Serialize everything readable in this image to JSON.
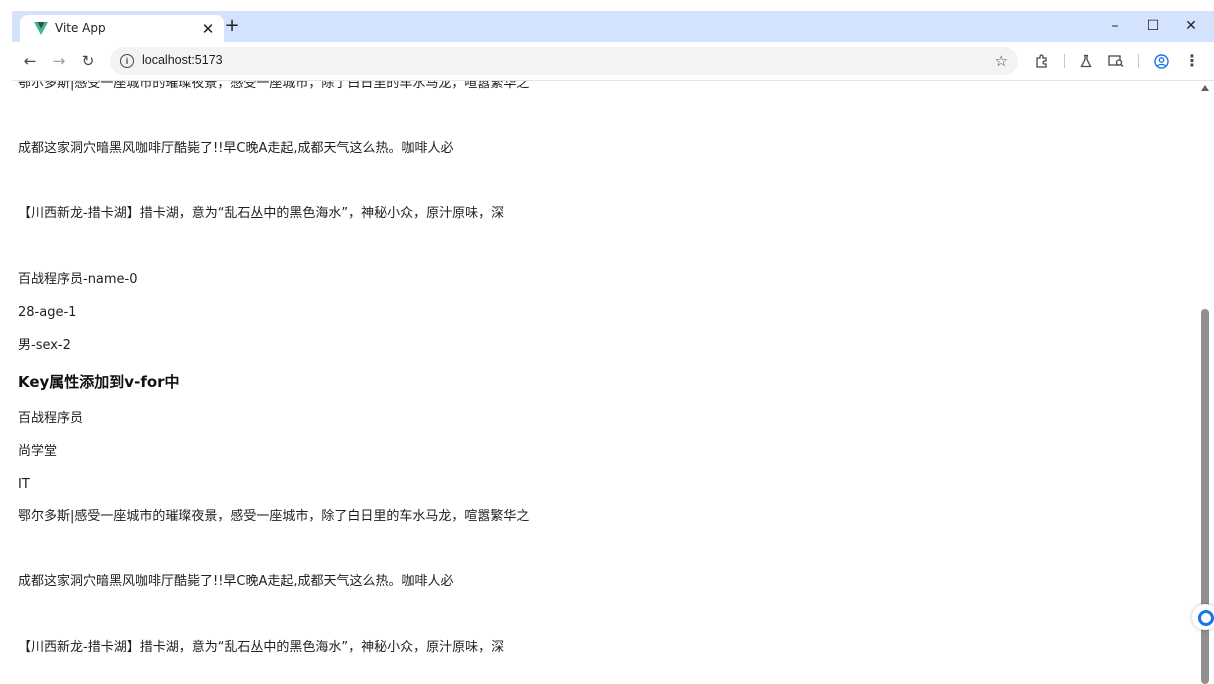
{
  "browser": {
    "tab_title": "Vite App",
    "tab_close": "✕",
    "new_tab": "+",
    "url": "localhost:5173",
    "window_controls": {
      "minimize": "–",
      "maximize": "☐",
      "close": "✕"
    },
    "icons": [
      "vue-logo-icon",
      "back-icon",
      "forward-icon",
      "reload-icon",
      "info-icon",
      "star-icon",
      "extensions-icon",
      "labs-icon",
      "search-tabs-icon",
      "profile-icon",
      "menu-icon"
    ]
  },
  "page": {
    "lines": [
      "鄂尔多斯|感受一座城市的璀璨夜景，感受一座城市，除了白日里的车水马龙，喧嚣繁华之",
      "成都这家洞穴暗黑风咖啡厅酷毙了!!早C晚A走起,成都天气这么热。咖啡人必",
      "【川西新龙-措卡湖】措卡湖，意为“乱石丛中的黑色海水”，神秘小众，原汁原味，深",
      "百战程序员-name-0",
      "28-age-1",
      "男-sex-2"
    ],
    "heading": "Key属性添加到v-for中",
    "list_items": [
      "百战程序员",
      "尚学堂",
      "IT",
      "鄂尔多斯|感受一座城市的璀璨夜景，感受一座城市，除了白日里的车水马龙，喧嚣繁华之",
      "成都这家洞穴暗黑风咖啡厅酷毙了!!早C晚A走起,成都天气这么热。咖啡人必",
      "【川西新龙-措卡湖】措卡湖，意为“乱石丛中的黑色海水”，神秘小众，原汁原味，深"
    ]
  }
}
